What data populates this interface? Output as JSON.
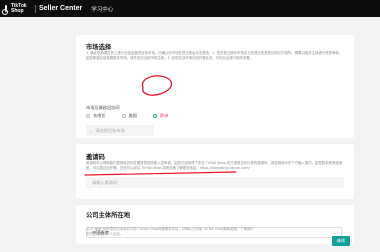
{
  "header": {
    "logo_line1": "TikTok",
    "logo_line2": "Shop",
    "brand": "Seller Center",
    "nav_tab": "学习中心"
  },
  "market": {
    "title": "市场选择",
    "description": "1. 确定您希望在其上进行业务运营的目标市场。已确认的市场在您注册后无法更改。2. 您在其注册的市场应与您提交的资质证明文件相符。需要对相关主体进行资质审核，如您希望后续拓展更多市场，请先完成当前市场注册。3. 如您在该市场已经开展业务，可在后台进行相关设置。",
    "sub_label": "市场及業務回訪网",
    "options": [
      "东南亚",
      "美国",
      "欧洲"
    ],
    "selected": "欧洲",
    "target_placeholder": "请选择目标市场"
  },
  "invite": {
    "title": "邀请码",
    "description": "邀请码可以帮助我们更快地识别并跟进您的商家入驻申请。如您已经获得了来自 TikTok Shop 官方或其合作伙伴的邀请码，请将其填写在下方输入框中。如您暂未获得邀请码，可以跳过此步骤，您也可以前往 TikTok Shop 招商页面了解更多信息：https://shandong.tiecon.com/",
    "placeholder": "请输入邀请码"
  },
  "entity": {
    "title": "公司主体所在地",
    "selected": "中国香港"
  },
  "footer": {
    "note": "点击“继续”即代表您已阅读并同意 TikTok Shop商家服务协议，并确认已阅读 TikTok Shop隐私政策，了解我们如何处理您的个人信息。"
  },
  "actions": {
    "next": "继续"
  },
  "colors": {
    "accent": "#14a09a",
    "header_bg": "#0d0d0d",
    "annotation": "#e8132b"
  }
}
